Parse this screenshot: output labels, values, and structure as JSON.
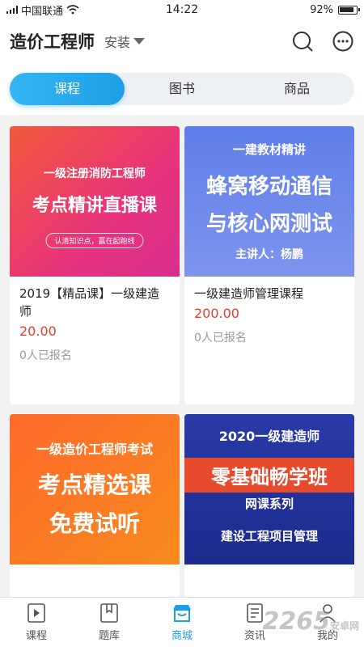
{
  "status_bar": {
    "carrier": "中国联通",
    "time": "14:22",
    "battery": "92%"
  },
  "header": {
    "title": "造价工程师",
    "region": "安装"
  },
  "tabs": [
    {
      "label": "课程",
      "active": true
    },
    {
      "label": "图书",
      "active": false
    },
    {
      "label": "商品",
      "active": false
    }
  ],
  "products": [
    {
      "thumb_lines": [
        "一级注册消防工程师",
        "考点精讲直播课"
      ],
      "thumb_tag": "认清知识点，赢在起跑线",
      "title": "2019【精品课】一级建造师",
      "price": "20.00",
      "enrolled": "0人已报名"
    },
    {
      "thumb_lines": [
        "一建教材精讲",
        "蜂窝移动通信",
        "与核心网测试",
        "主讲人：杨鹏"
      ],
      "title": "一级建造师管理课程",
      "price": "200.00",
      "enrolled": "0人已报名"
    },
    {
      "thumb_lines": [
        "一级造价工程师考试",
        "考点精选课",
        "免费试听"
      ]
    },
    {
      "thumb_lines": [
        "2020一级建造师",
        "零基础畅学班",
        "网课系列",
        "建设工程项目管理"
      ]
    }
  ],
  "bottom_nav": [
    {
      "label": "课程",
      "icon": "play-video-icon",
      "active": false
    },
    {
      "label": "题库",
      "icon": "book-icon",
      "active": false
    },
    {
      "label": "商城",
      "icon": "store-icon",
      "active": true
    },
    {
      "label": "资讯",
      "icon": "news-icon",
      "active": false
    },
    {
      "label": "我的",
      "icon": "profile-icon",
      "active": false
    }
  ],
  "watermark": {
    "text": "2265",
    "suffix": "安卓网"
  },
  "colors": {
    "accent": "#1e9ee6",
    "price": "#e2402f"
  }
}
